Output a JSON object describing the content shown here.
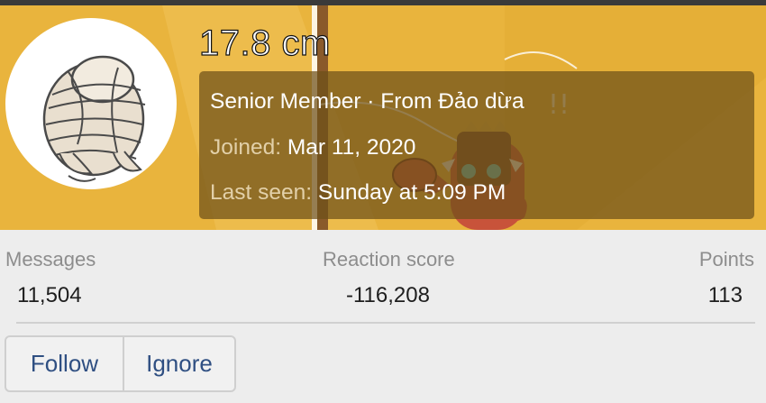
{
  "profile": {
    "username": "17.8 cm",
    "title_line": "Senior Member · From Đảo dừa",
    "joined_label": "Joined:",
    "joined_value": "Mar 11, 2020",
    "last_seen_label": "Last seen:",
    "last_seen_value": "Sunday at 5:09 PM",
    "avatar_icon": "bandaged-figure-icon"
  },
  "stats": [
    {
      "label": "Messages",
      "value": "11,504"
    },
    {
      "label": "Reaction score",
      "value": "-116,208"
    },
    {
      "label": "Points",
      "value": "113"
    }
  ],
  "actions": {
    "follow_label": "Follow",
    "ignore_label": "Ignore"
  },
  "colors": {
    "banner": "#e9b43d",
    "link": "#2f4f82"
  }
}
